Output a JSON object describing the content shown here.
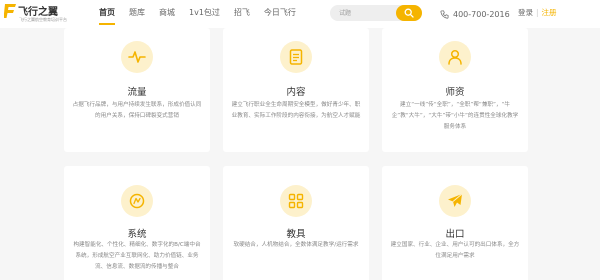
{
  "brand": {
    "name": "飞行之翼",
    "tagline": "飞行之翼航空教育培训平台"
  },
  "nav": {
    "items": [
      {
        "label": "首页",
        "active": true
      },
      {
        "label": "题库",
        "active": false
      },
      {
        "label": "商城",
        "active": false
      },
      {
        "label": "1v1包过",
        "active": false
      },
      {
        "label": "招飞",
        "active": false
      },
      {
        "label": "今日飞行",
        "active": false
      }
    ]
  },
  "search": {
    "placeholder": "试题"
  },
  "contact": {
    "phone": "400-700-2016"
  },
  "auth": {
    "login": "登录",
    "separator": "|",
    "register": "注册"
  },
  "cards": [
    {
      "title": "流量",
      "icon": "pulse-icon",
      "desc": "占据飞行品牌，与用户持续发生联系，形成价值认同的用户关系，保持口碑裂变式营销"
    },
    {
      "title": "内容",
      "icon": "document-icon",
      "desc": "建立飞行职业全生命周期安全模型，做好青少年、职业教育、实际工作阶段的内容衔接，为航空人才赋能"
    },
    {
      "title": "师资",
      "icon": "teacher-icon",
      "desc": "建立“一线”传“全职”，“全职”帮“兼职”，“牛企”教“大牛”，“大牛”带“小牛”的连贯性全球化教学服务体系"
    },
    {
      "title": "系统",
      "icon": "system-icon",
      "desc": "构建智能化、个性化、精细化、数字化的B/C端中台系统，形成航空产业互联网化、助力价值链、业务流、信息流、数据流的传播与整合"
    },
    {
      "title": "教具",
      "icon": "grid-icon",
      "desc": "软硬结合，人机物结合，全数体满足教学/运行需求"
    },
    {
      "title": "出口",
      "icon": "plane-icon",
      "desc": "建立国家、行业、企业、用户认可的出口体系，全方位满足用户需求"
    }
  ],
  "colors": {
    "accent": "#f5b400",
    "icon_bg": "#fdf1cc",
    "page_bg": "#f6f6f6"
  }
}
